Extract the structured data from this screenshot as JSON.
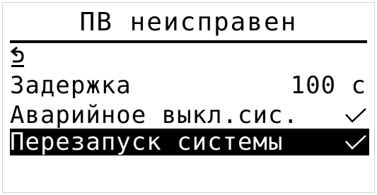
{
  "screen": {
    "title": "ПВ неисправен",
    "back_icon": "back-arrow-icon",
    "items": [
      {
        "label": "Задержка",
        "value": "100 с",
        "selected": false
      },
      {
        "label": "Аварийное выкл.сис.",
        "value": "",
        "checked": true,
        "selected": false
      },
      {
        "label": "Перезапуск системы",
        "value": "",
        "checked": true,
        "selected": true
      }
    ]
  },
  "colors": {
    "foreground": "#000000",
    "background": "#ffffff",
    "selection": "#000000"
  }
}
